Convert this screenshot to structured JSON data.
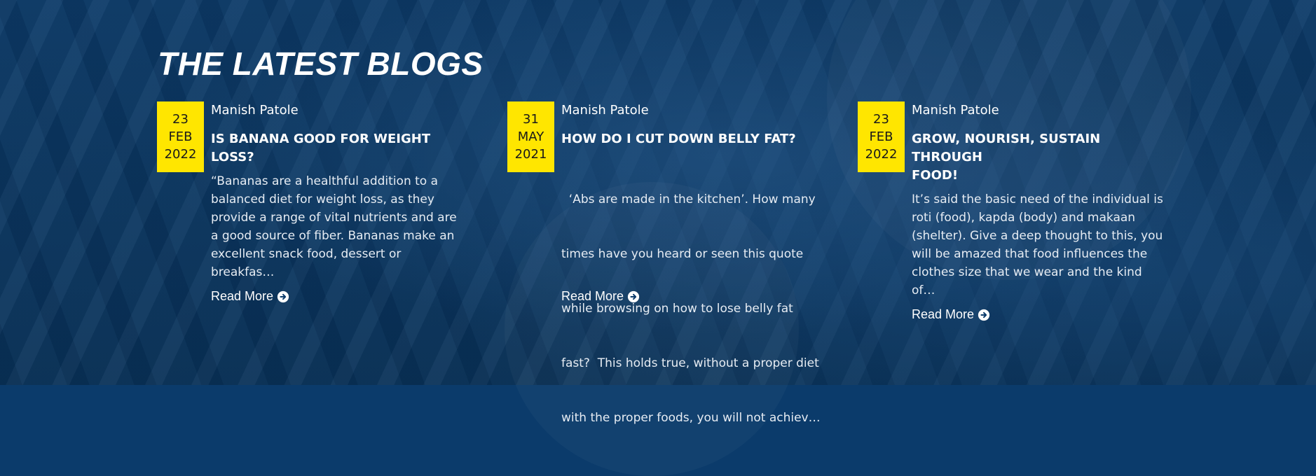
{
  "section": {
    "title": "THE LATEST BLOGS"
  },
  "posts": [
    {
      "day": "23",
      "month": "FEB",
      "year": "2022",
      "author": "Manish Patole",
      "title": "IS BANANA GOOD FOR WEIGHT LOSS?",
      "excerpt_lines": [
        "“Bananas are a healthful addition to a",
        "balanced diet for weight loss, as they",
        "provide a range of vital nutrients and are",
        "a good source of fiber. Bananas make an",
        "excellent snack food, dessert or breakfas…"
      ],
      "read_more": "Read More"
    },
    {
      "day": "31",
      "month": "MAY",
      "year": "2021",
      "author": "Manish Patole",
      "title": "HOW DO I CUT DOWN BELLY FAT?",
      "excerpt_lines": [
        "  ‘Abs are made in the kitchen’. How many",
        "times have you heard or seen this quote",
        "while browsing on how to lose belly fat",
        "fast?  This holds true, without a proper diet",
        "with the proper foods, you will not achiev…"
      ],
      "read_more": "Read More"
    },
    {
      "day": "23",
      "month": "FEB",
      "year": "2022",
      "author": "Manish Patole",
      "title_lines": [
        "GROW, NOURISH, SUSTAIN THROUGH",
        "FOOD!"
      ],
      "excerpt_lines": [
        "It’s said the basic need of the individual is",
        "roti (food), kapda (body) and makaan",
        "(shelter). Give a deep thought to this, you",
        "will be amazed that food influences the",
        "clothes size that we wear and the kind of…"
      ],
      "read_more": "Read More"
    }
  ],
  "colors": {
    "background": "#0b3b6b",
    "date_box": "#ffe600",
    "text": "#ffffff"
  },
  "icons": {
    "read_more": "circle-arrow-right-icon"
  }
}
